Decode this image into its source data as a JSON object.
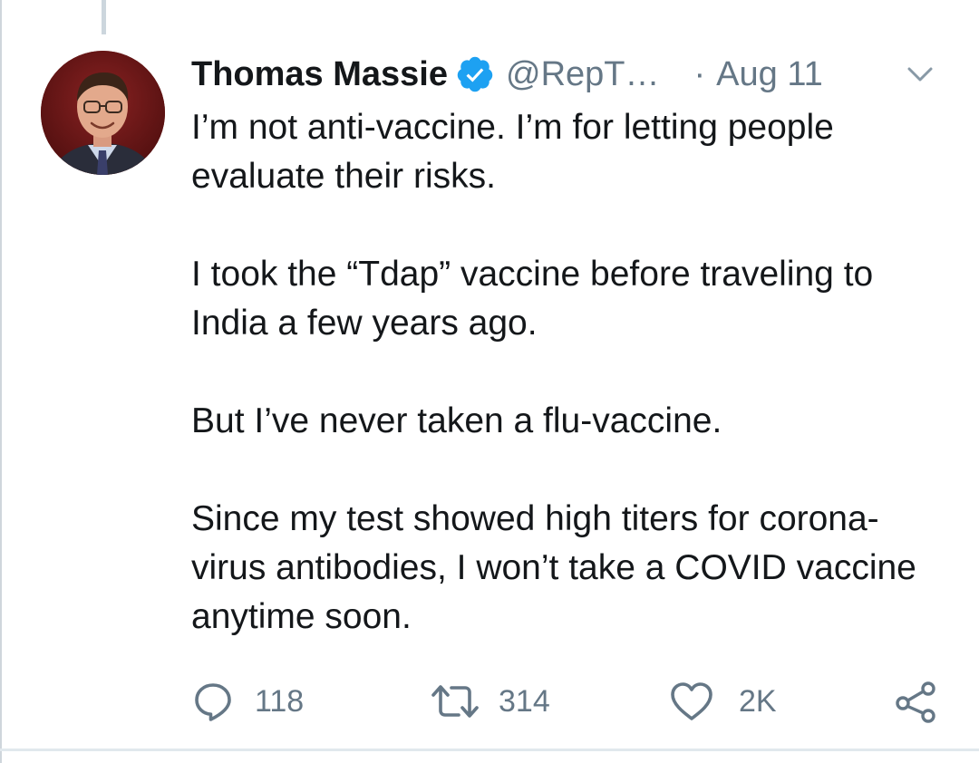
{
  "tweet": {
    "author_name": "Thomas Massie",
    "handle": "@RepT…",
    "separator": "·",
    "date": "Aug 11",
    "paragraphs": [
      "I’m not anti-vaccine. I’m for letting people evaluate their risks.",
      "I took the “Tdap” vaccine before traveling to India a few years ago.",
      "But I’ve never taken a flu-vaccine.",
      "Since my test showed high titers for corona-virus antibodies, I won’t take a COVID vaccine anytime soon."
    ]
  },
  "actions": {
    "reply_count": "118",
    "retweet_count": "314",
    "like_count": "2K"
  },
  "icons": {
    "verified": "verified-badge-icon",
    "menu": "chevron-down-icon",
    "reply": "reply-icon",
    "retweet": "retweet-icon",
    "like": "heart-icon",
    "share": "share-icon"
  },
  "colors": {
    "verified_blue": "#1da1f2",
    "text_primary": "#14171a",
    "text_secondary": "#657786",
    "divider": "#e1e8ed"
  }
}
